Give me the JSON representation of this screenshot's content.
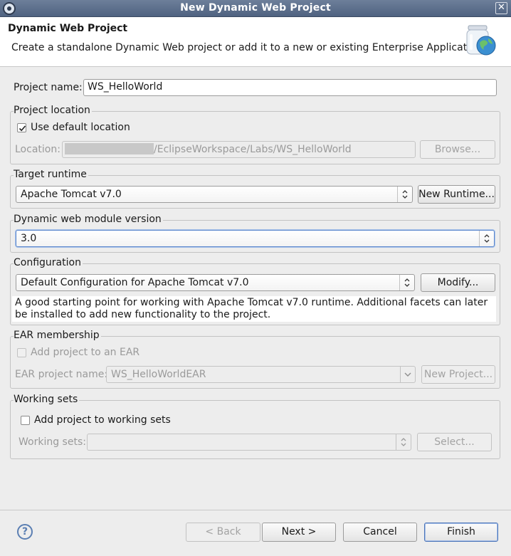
{
  "window": {
    "title": "New Dynamic Web Project",
    "close_glyph": "✕"
  },
  "header": {
    "title": "Dynamic Web Project",
    "description": "Create a standalone Dynamic Web project or add it to a new or existing Enterprise Application.",
    "icon": "jar-globe-icon"
  },
  "project_name": {
    "label": "Project name:",
    "value": "WS_HelloWorld"
  },
  "project_location": {
    "group_label": "Project location",
    "use_default_label": "Use default location",
    "use_default_checked": true,
    "location_label": "Location:",
    "location_value": "/EclipseWorkspace/Labs/WS_HelloWorld",
    "browse_label": "Browse..."
  },
  "target_runtime": {
    "group_label": "Target runtime",
    "selected": "Apache Tomcat v7.0",
    "new_runtime_label": "New Runtime..."
  },
  "module_version": {
    "group_label": "Dynamic web module version",
    "selected": "3.0"
  },
  "configuration": {
    "group_label": "Configuration",
    "selected": "Default Configuration for Apache Tomcat v7.0",
    "modify_label": "Modify...",
    "description": "A good starting point for working with Apache Tomcat v7.0 runtime. Additional facets can later be installed to add new functionality to the project."
  },
  "ear": {
    "group_label": "EAR membership",
    "add_label": "Add project to an EAR",
    "add_checked": false,
    "name_label": "EAR project name:",
    "name_value": "WS_HelloWorldEAR",
    "new_project_label": "New Project..."
  },
  "working_sets": {
    "group_label": "Working sets",
    "add_label": "Add project to working sets",
    "add_checked": false,
    "sets_label": "Working sets:",
    "sets_value": "",
    "select_label": "Select..."
  },
  "footer": {
    "help_glyph": "?",
    "back_label": "< Back",
    "next_label": "Next >",
    "cancel_label": "Cancel",
    "finish_label": "Finish"
  }
}
